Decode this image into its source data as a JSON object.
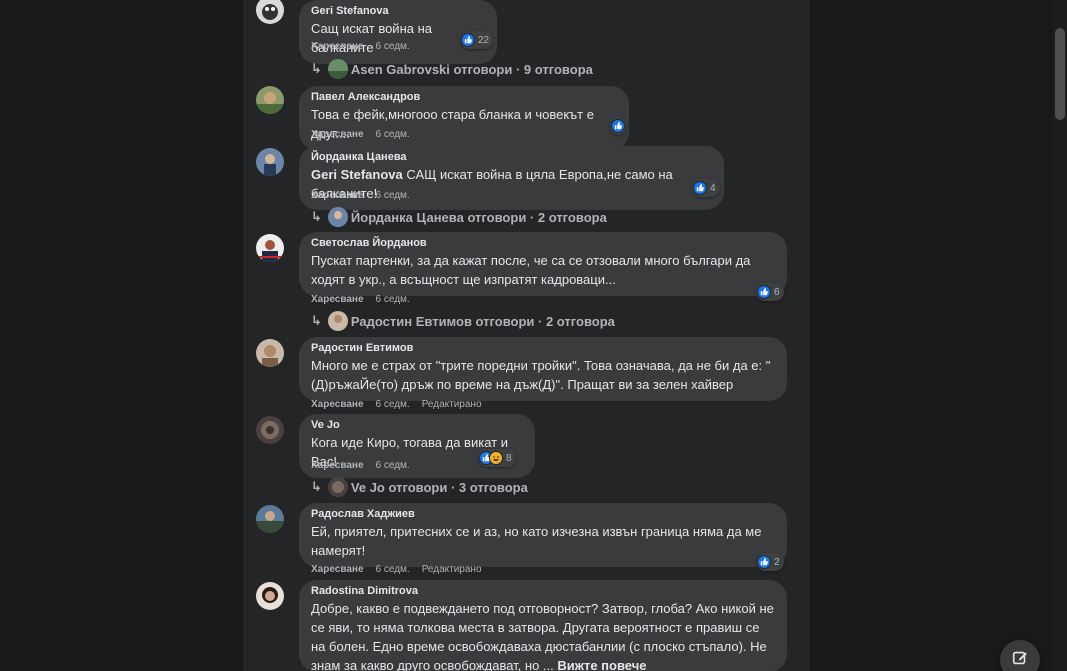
{
  "like_label": "Харесване",
  "edited_label": "Редактирано",
  "see_more": "Вижте повече",
  "comments": [
    {
      "author": "Geri Stefanova",
      "text": "Сащ искат война на балканите",
      "time": "6 седм.",
      "reactions": "22",
      "replies": "Asen Gabrovski отговори · 9 отговора"
    },
    {
      "author": "Павел Александров",
      "text": "Това е фейк,многооо стара бланка и човекът е друг...."
    },
    {
      "author": "Йорданка Цанева",
      "mention": "Geri Stefanova",
      "text": " САЩ искат война в цяла Европа,не само на балканите!",
      "time": "6 седм.",
      "reactions": "4",
      "replies": "Йорданка Цанева отговори · 2 отговора"
    },
    {
      "author": "Светослав Йорданов",
      "text": "Пускат партенки, за да кажат после, че са се отзовали много българи да ходят в укр., а всъщност ще изпратят кадроваци...",
      "time": "6 седм.",
      "reactions": "6",
      "replies": "Радостин Евтимов отговори · 2 отговора"
    },
    {
      "author": "Радостин Евтимов",
      "text": "Много ме е страх от \"трите поредни тройки\". Това означава, да не би да е: \"(Д)ръжаЙе(то) дръж по време на дъж(Д)\". Пращат ви за зелен хайвер",
      "time": "6 седм."
    },
    {
      "author": "Ve Jo",
      "text": "Кога иде Киро, тогава да викат и Вас!",
      "time": "6 седм.",
      "reactions": "8",
      "replies": "Ve Jo отговори · 3 отговора"
    },
    {
      "author": "Радослав Хаджиев",
      "text": "Ей, приятел, притесних се и аз, но като изчезна извън граница няма да ме намерят!",
      "time": "6 седм.",
      "reactions": "2"
    },
    {
      "author": "Radostina Dimitrova",
      "text": "Добре, какво е подвеждането под отговорност? Затвор, глоба? Ако никой не се яви, то няма толкова места в затвора. Другата вероятност е правиш се на болен. Едно време освобождаваха дюстабанлии (с плоско стъпало). Не знам за какво друго освобождават, но ..."
    }
  ],
  "colors": {
    "like_blue": "#1877f2",
    "bubble": "#3a3b3c",
    "panel": "#242526",
    "page": "#18191a"
  }
}
